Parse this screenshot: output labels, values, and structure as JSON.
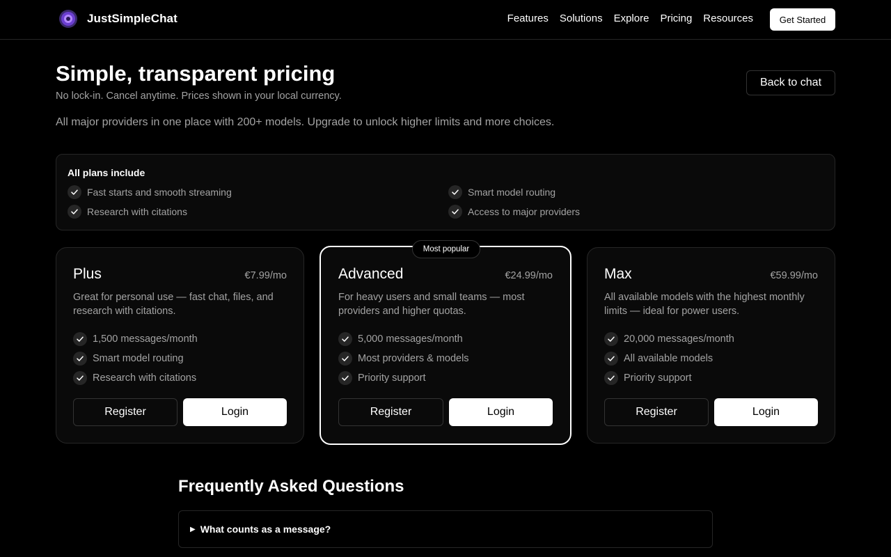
{
  "brand": {
    "name": "JustSimpleChat",
    "accent": "#7c4dff"
  },
  "nav": {
    "links": [
      "Features",
      "Solutions",
      "Explore",
      "Pricing",
      "Resources"
    ],
    "cta": "Get Started"
  },
  "hero": {
    "title": "Simple, transparent pricing",
    "subtitle": "No lock-in. Cancel anytime. Prices shown in your local currency.",
    "description": "All major providers in one place with 200+ models. Upgrade to unlock higher limits and more choices.",
    "back_button": "Back to chat"
  },
  "includes": {
    "title": "All plans include",
    "items": [
      "Fast starts and smooth streaming",
      "Smart model routing",
      "Research with citations",
      "Access to major providers"
    ]
  },
  "plans": [
    {
      "name": "Plus",
      "price": "€7.99/mo",
      "description": "Great for personal use — fast chat, files, and research with citations.",
      "features": [
        "1,500 messages/month",
        "Smart model routing",
        "Research with citations"
      ],
      "register": "Register",
      "login": "Login"
    },
    {
      "name": "Advanced",
      "price": "€24.99/mo",
      "badge": "Most popular",
      "description": "For heavy users and small teams — most providers and higher quotas.",
      "features": [
        "5,000 messages/month",
        "Most providers & models",
        "Priority support"
      ],
      "register": "Register",
      "login": "Login"
    },
    {
      "name": "Max",
      "price": "€59.99/mo",
      "description": "All available models with the highest monthly limits — ideal for power users.",
      "features": [
        "20,000 messages/month",
        "All available models",
        "Priority support"
      ],
      "register": "Register",
      "login": "Login"
    }
  ],
  "faq": {
    "title": "Frequently Asked Questions",
    "items": [
      {
        "question": "What counts as a message?",
        "expanded": false
      }
    ]
  },
  "icons": {
    "check": "check-icon",
    "logo": "brand-logo-icon",
    "disclosure": "triangle-right-icon"
  }
}
